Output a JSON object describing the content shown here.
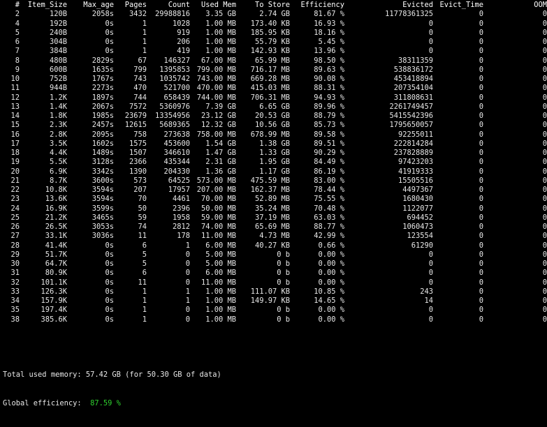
{
  "colors": {
    "background": "#000000",
    "text": "#e8e8e8",
    "highlight_green": "#2fd02f"
  },
  "table": {
    "headers": [
      "#",
      "Item_Size",
      "Max_age",
      "Pages",
      "Count",
      "Used Mem",
      "To Store",
      "Efficiency",
      "Evicted",
      "Evict_Time",
      "OOM"
    ],
    "rows": [
      [
        "2",
        "120B",
        "2058s",
        "3432",
        "29988816",
        "3.35 GB",
        "2.74 GB",
        "81.67 %",
        "11778361325",
        "0",
        "0"
      ],
      [
        "4",
        "192B",
        "0s",
        "1",
        "1028",
        "1.00 MB",
        "173.40 KB",
        "16.93 %",
        "0",
        "0",
        "0"
      ],
      [
        "5",
        "240B",
        "0s",
        "1",
        "919",
        "1.00 MB",
        "185.95 KB",
        "18.16 %",
        "0",
        "0",
        "0"
      ],
      [
        "6",
        "304B",
        "0s",
        "1",
        "206",
        "1.00 MB",
        "55.79 KB",
        "5.45 %",
        "0",
        "0",
        "0"
      ],
      [
        "7",
        "384B",
        "0s",
        "1",
        "419",
        "1.00 MB",
        "142.93 KB",
        "13.96 %",
        "0",
        "0",
        "0"
      ],
      [
        "8",
        "480B",
        "2829s",
        "67",
        "146327",
        "67.00 MB",
        "65.99 MB",
        "98.50 %",
        "38311359",
        "0",
        "0"
      ],
      [
        "9",
        "600B",
        "1635s",
        "799",
        "1395853",
        "799.00 MB",
        "716.17 MB",
        "89.63 %",
        "538836172",
        "0",
        "0"
      ],
      [
        "10",
        "752B",
        "1767s",
        "743",
        "1035742",
        "743.00 MB",
        "669.28 MB",
        "90.08 %",
        "453418894",
        "0",
        "0"
      ],
      [
        "11",
        "944B",
        "2273s",
        "470",
        "521700",
        "470.00 MB",
        "415.03 MB",
        "88.31 %",
        "207354104",
        "0",
        "0"
      ],
      [
        "12",
        "1.2K",
        "1897s",
        "744",
        "658439",
        "744.00 MB",
        "706.31 MB",
        "94.93 %",
        "311808631",
        "0",
        "0"
      ],
      [
        "13",
        "1.4K",
        "2067s",
        "7572",
        "5360976",
        "7.39 GB",
        "6.65 GB",
        "89.96 %",
        "2261749457",
        "0",
        "0"
      ],
      [
        "14",
        "1.8K",
        "1985s",
        "23679",
        "13354956",
        "23.12 GB",
        "20.53 GB",
        "88.79 %",
        "5415542396",
        "0",
        "0"
      ],
      [
        "15",
        "2.3K",
        "2457s",
        "12615",
        "5689365",
        "12.32 GB",
        "10.56 GB",
        "85.73 %",
        "1795650057",
        "0",
        "0"
      ],
      [
        "16",
        "2.8K",
        "2095s",
        "758",
        "273638",
        "758.00 MB",
        "678.99 MB",
        "89.58 %",
        "92255011",
        "0",
        "0"
      ],
      [
        "17",
        "3.5K",
        "1602s",
        "1575",
        "453600",
        "1.54 GB",
        "1.38 GB",
        "89.51 %",
        "222814284",
        "0",
        "0"
      ],
      [
        "18",
        "4.4K",
        "1489s",
        "1507",
        "346610",
        "1.47 GB",
        "1.33 GB",
        "90.29 %",
        "237828889",
        "0",
        "0"
      ],
      [
        "19",
        "5.5K",
        "3128s",
        "2366",
        "435344",
        "2.31 GB",
        "1.95 GB",
        "84.49 %",
        "97423203",
        "0",
        "0"
      ],
      [
        "20",
        "6.9K",
        "3342s",
        "1390",
        "204330",
        "1.36 GB",
        "1.17 GB",
        "86.19 %",
        "41919333",
        "0",
        "0"
      ],
      [
        "21",
        "8.7K",
        "3600s",
        "573",
        "64525",
        "573.00 MB",
        "475.59 MB",
        "83.00 %",
        "15505516",
        "0",
        "0"
      ],
      [
        "22",
        "10.8K",
        "3594s",
        "207",
        "17957",
        "207.00 MB",
        "162.37 MB",
        "78.44 %",
        "4497367",
        "0",
        "0"
      ],
      [
        "23",
        "13.6K",
        "3594s",
        "70",
        "4461",
        "70.00 MB",
        "52.89 MB",
        "75.55 %",
        "1680430",
        "0",
        "0"
      ],
      [
        "24",
        "16.9K",
        "3599s",
        "50",
        "2396",
        "50.00 MB",
        "35.24 MB",
        "70.48 %",
        "1122077",
        "0",
        "0"
      ],
      [
        "25",
        "21.2K",
        "3465s",
        "59",
        "1958",
        "59.00 MB",
        "37.19 MB",
        "63.03 %",
        "694452",
        "0",
        "0"
      ],
      [
        "26",
        "26.5K",
        "3053s",
        "74",
        "2812",
        "74.00 MB",
        "65.69 MB",
        "88.77 %",
        "1060473",
        "0",
        "0"
      ],
      [
        "27",
        "33.1K",
        "3036s",
        "11",
        "178",
        "11.00 MB",
        "4.73 MB",
        "42.99 %",
        "123554",
        "0",
        "0"
      ],
      [
        "28",
        "41.4K",
        "0s",
        "6",
        "1",
        "6.00 MB",
        "40.27 KB",
        "0.66 %",
        "61290",
        "0",
        "0"
      ],
      [
        "29",
        "51.7K",
        "0s",
        "5",
        "0",
        "5.00 MB",
        "0 b",
        "0.00 %",
        "0",
        "0",
        "0"
      ],
      [
        "30",
        "64.7K",
        "0s",
        "5",
        "0",
        "5.00 MB",
        "0 b",
        "0.00 %",
        "0",
        "0",
        "0"
      ],
      [
        "31",
        "80.9K",
        "0s",
        "6",
        "0",
        "6.00 MB",
        "0 b",
        "0.00 %",
        "0",
        "0",
        "0"
      ],
      [
        "32",
        "101.1K",
        "0s",
        "11",
        "0",
        "11.00 MB",
        "0 b",
        "0.00 %",
        "0",
        "0",
        "0"
      ],
      [
        "33",
        "126.3K",
        "0s",
        "1",
        "1",
        "1.00 MB",
        "111.07 KB",
        "10.85 %",
        "243",
        "0",
        "0"
      ],
      [
        "34",
        "157.9K",
        "0s",
        "1",
        "1",
        "1.00 MB",
        "149.97 KB",
        "14.65 %",
        "14",
        "0",
        "0"
      ],
      [
        "35",
        "197.4K",
        "0s",
        "1",
        "0",
        "1.00 MB",
        "0 b",
        "0.00 %",
        "0",
        "0",
        "0"
      ],
      [
        "38",
        "385.6K",
        "0s",
        "1",
        "0",
        "1.00 MB",
        "0 b",
        "0.00 %",
        "0",
        "0",
        "0"
      ]
    ]
  },
  "summary": {
    "total_label": "Total used memory:",
    "total_value": "57.42 GB (for 50.30 GB of data)",
    "global_label": "Global efficiency:",
    "global_value": "87.59 %"
  }
}
